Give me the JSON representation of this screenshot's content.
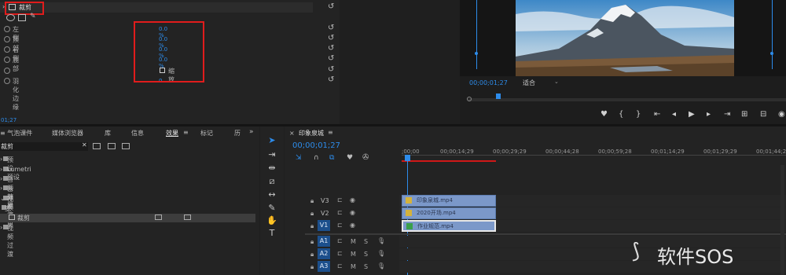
{
  "effect_controls": {
    "effect_name": "裁剪",
    "properties": [
      {
        "label": "左侧",
        "value": "0.0 %"
      },
      {
        "label": "顶部",
        "value": "0.0 %"
      },
      {
        "label": "右侧",
        "value": "0.0 %"
      },
      {
        "label": "底部",
        "value": "0.0 %"
      }
    ],
    "zoom_label": "缩放",
    "feather_label": "羽化边缘",
    "feather_value": "0",
    "timecode": "01;27"
  },
  "program_monitor": {
    "timecode": "00;00;01;27",
    "fit_option": "适合"
  },
  "project_panel": {
    "tabs": [
      "气泡课件",
      "媒体浏览器",
      "库",
      "信息",
      "效果",
      "标记",
      "历"
    ],
    "search_value": "裁剪",
    "tree": [
      "预设",
      "Lumetri 预设",
      "音频效果",
      "音频过渡",
      "视频效果",
      "变换",
      "裁剪",
      "视频过渡"
    ]
  },
  "timeline": {
    "sequence_name": "印象泉城",
    "timecode": "00;00;01;27",
    "ruler": [
      ";00;00",
      "00;00;14;29",
      "00;00;29;29",
      "00;00;44;28",
      "00;00;59;28",
      "00;01;14;29",
      "00;01;29;29",
      "00;01;44;28"
    ],
    "video_tracks": [
      "V3",
      "V2",
      "V1"
    ],
    "audio_tracks": [
      "A1",
      "A2",
      "A3"
    ],
    "clips": [
      {
        "name": "印象泉城.mp4"
      },
      {
        "name": "2020开场.mp4"
      },
      {
        "name": "作业规范.mp4"
      }
    ],
    "track_letters": {
      "mute": "M",
      "solo": "S"
    }
  },
  "watermark": "软件SOS",
  "colors": {
    "accent": "#2d8ceb",
    "highlight": "#e01c1c",
    "clip": "#7b98c9"
  }
}
